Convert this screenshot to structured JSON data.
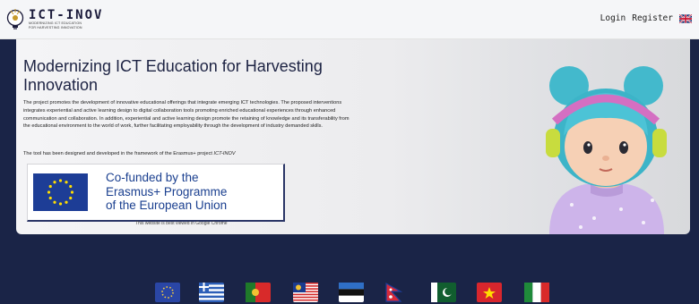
{
  "header": {
    "logo_title": "ICT-INOV",
    "logo_subtitle_line1": "MODERNIZING ICT EDUCATION",
    "logo_subtitle_line2": "FOR HARVESTING INNOVATION",
    "login_label": "Login",
    "register_label": "Register",
    "language_flag": "uk-flag-icon"
  },
  "hero": {
    "title": "Modernizing ICT Education for Harvesting Innovation",
    "description": "The project promotes the development of innovative educational offerings that integrate emerging ICT technologies. The proposed interventions integrates experiential and active learning design to digital collaboration tools promoting enriched educational experiences through enhanced communication and collaboration. In addition, experiential and active learning design promote the retaining of knowledge and its transferability from the educational environment to the world of work, further facilitating employability through the development of industry demanded skills.",
    "note_prefix": "The tool has been designed and developed in the framework of the Erasmus+ project ",
    "note_project": "ICT-INOV",
    "erasmus_line1": "Co-funded by the",
    "erasmus_line2": "Erasmus+ Programme",
    "erasmus_line3": "of the European Union",
    "browser_note": "This website is best viewed in Google Chrome"
  },
  "footer_flags": [
    "eu-flag-icon",
    "greece-flag-icon",
    "portugal-flag-icon",
    "malaysia-flag-icon",
    "estonia-flag-icon",
    "nepal-flag-icon",
    "pakistan-flag-icon",
    "vietnam-flag-icon",
    "italy-flag-icon"
  ],
  "colors": {
    "background": "#1a2447",
    "title": "#1d2343",
    "erasmus_blue": "#1a3f8f"
  }
}
